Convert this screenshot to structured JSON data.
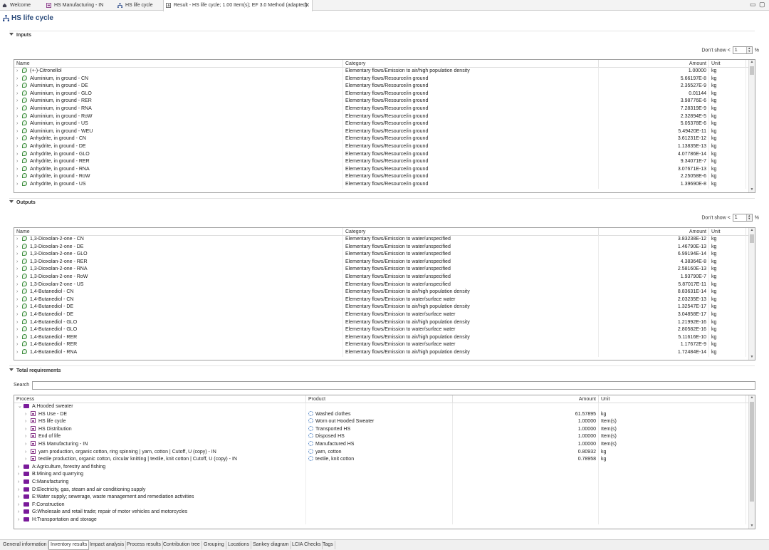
{
  "tabs": [
    {
      "label": "Welcome"
    },
    {
      "label": "HS Manufacturing - IN"
    },
    {
      "label": "HS life cycle"
    },
    {
      "label": "Result - HS life cycle; 1.00 Item(s); EF 3.0 Method (adapted)"
    }
  ],
  "window_controls": {
    "minimize": "▭",
    "maximize": "▢"
  },
  "page_title": "HS life cycle",
  "inputs": {
    "section_label": "Inputs",
    "dont_show_label": "Don't show <",
    "dont_show_value": "1",
    "percent": "%",
    "columns": [
      "Name",
      "Category",
      "Amount",
      "Unit"
    ],
    "rows": [
      [
        "(+-)-Citronellol",
        "Elementary flows/Emission to air/high population density",
        "1.00000",
        "kg"
      ],
      [
        "Aluminium, in ground - CN",
        "Elementary flows/Resource/in ground",
        "5.66197E-8",
        "kg"
      ],
      [
        "Aluminium, in ground - DE",
        "Elementary flows/Resource/in ground",
        "2.35527E-9",
        "kg"
      ],
      [
        "Aluminium, in ground - GLO",
        "Elementary flows/Resource/in ground",
        "0.01144",
        "kg"
      ],
      [
        "Aluminium, in ground - RER",
        "Elementary flows/Resource/in ground",
        "3.98776E-6",
        "kg"
      ],
      [
        "Aluminium, in ground - RNA",
        "Elementary flows/Resource/in ground",
        "7.28319E-9",
        "kg"
      ],
      [
        "Aluminium, in ground - RoW",
        "Elementary flows/Resource/in ground",
        "2.32894E-5",
        "kg"
      ],
      [
        "Aluminium, in ground - US",
        "Elementary flows/Resource/in ground",
        "5.05378E-6",
        "kg"
      ],
      [
        "Aluminium, in ground - WEU",
        "Elementary flows/Resource/in ground",
        "5.49420E-11",
        "kg"
      ],
      [
        "Anhydrite, in ground - CN",
        "Elementary flows/Resource/in ground",
        "3.61231E-12",
        "kg"
      ],
      [
        "Anhydrite, in ground - DE",
        "Elementary flows/Resource/in ground",
        "1.13835E-13",
        "kg"
      ],
      [
        "Anhydrite, in ground - GLO",
        "Elementary flows/Resource/in ground",
        "4.07786E-14",
        "kg"
      ],
      [
        "Anhydrite, in ground - RER",
        "Elementary flows/Resource/in ground",
        "9.34071E-7",
        "kg"
      ],
      [
        "Anhydrite, in ground - RNA",
        "Elementary flows/Resource/in ground",
        "3.07671E-13",
        "kg"
      ],
      [
        "Anhydrite, in ground - RoW",
        "Elementary flows/Resource/in ground",
        "2.25058E-6",
        "kg"
      ],
      [
        "Anhydrite, in ground - US",
        "Elementary flows/Resource/in ground",
        "1.39690E-8",
        "kg"
      ]
    ]
  },
  "outputs": {
    "section_label": "Outputs",
    "dont_show_label": "Don't show <",
    "dont_show_value": "1",
    "percent": "%",
    "columns": [
      "Name",
      "Category",
      "Amount",
      "Unit"
    ],
    "rows": [
      [
        "1,3-Dioxolan-2-one - CN",
        "Elementary flows/Emission to water/unspecified",
        "3.83238E-12",
        "kg"
      ],
      [
        "1,3-Dioxolan-2-one - DE",
        "Elementary flows/Emission to water/unspecified",
        "1.46790E-13",
        "kg"
      ],
      [
        "1,3-Dioxolan-2-one - GLO",
        "Elementary flows/Emission to water/unspecified",
        "6.99194E-14",
        "kg"
      ],
      [
        "1,3-Dioxolan-2-one - RER",
        "Elementary flows/Emission to water/unspecified",
        "4.38364E-8",
        "kg"
      ],
      [
        "1,3-Dioxolan-2-one - RNA",
        "Elementary flows/Emission to water/unspecified",
        "2.58160E-13",
        "kg"
      ],
      [
        "1,3-Dioxolan-2-one - RoW",
        "Elementary flows/Emission to water/unspecified",
        "1.93790E-7",
        "kg"
      ],
      [
        "1,3-Dioxolan-2-one - US",
        "Elementary flows/Emission to water/unspecified",
        "5.87017E-11",
        "kg"
      ],
      [
        "1,4-Butanediol - CN",
        "Elementary flows/Emission to air/high population density",
        "8.83631E-14",
        "kg"
      ],
      [
        "1,4-Butanediol - CN",
        "Elementary flows/Emission to water/surface water",
        "2.03235E-13",
        "kg"
      ],
      [
        "1,4-Butanediol - DE",
        "Elementary flows/Emission to air/high population density",
        "1.32547E-17",
        "kg"
      ],
      [
        "1,4-Butanediol - DE",
        "Elementary flows/Emission to water/surface water",
        "3.04858E-17",
        "kg"
      ],
      [
        "1,4-Butanediol - GLO",
        "Elementary flows/Emission to air/high population density",
        "1.21992E-16",
        "kg"
      ],
      [
        "1,4-Butanediol - GLO",
        "Elementary flows/Emission to water/surface water",
        "2.80582E-16",
        "kg"
      ],
      [
        "1,4-Butanediol - RER",
        "Elementary flows/Emission to air/high population density",
        "5.11616E-10",
        "kg"
      ],
      [
        "1,4-Butanediol - RER",
        "Elementary flows/Emission to water/surface water",
        "1.17672E-9",
        "kg"
      ],
      [
        "1,4-Butanediol - RNA",
        "Elementary flows/Emission to air/high population density",
        "1.72484E-14",
        "kg"
      ]
    ]
  },
  "total_requirements": {
    "section_label": "Total requirements",
    "search_label": "Search",
    "search_value": "",
    "columns": [
      "Process",
      "Product",
      "Amount",
      "Unit"
    ],
    "group": {
      "label": "A:Hooded sweater",
      "expanded": true
    },
    "processes": [
      [
        "HS Use - DE",
        "Washed clothes",
        "61.57895",
        "kg"
      ],
      [
        "HS life cycle",
        "Worn out Hooded Sweater",
        "1.00000",
        "Item(s)"
      ],
      [
        "HS Distribution",
        "Transported HS",
        "1.00000",
        "Item(s)"
      ],
      [
        "End of life",
        "Disposed HS",
        "1.00000",
        "Item(s)"
      ],
      [
        "HS Manufacturing - IN",
        "Manufactured HS",
        "1.00000",
        "Item(s)"
      ],
      [
        "yarn production, organic cotton, ring spinning | yarn, cotton | Cutoff, U (copy) - IN",
        "yarn, cotton",
        "0.80932",
        "kg"
      ],
      [
        "textile production, organic cotton, circular knitting | textile, knit cotton | Cutoff, U (copy) - IN",
        "textile, knit cotton",
        "0.78958",
        "kg"
      ]
    ],
    "categories": [
      "A:Agriculture, forestry and fishing",
      "B:Mining and quarrying",
      "C:Manufacturing",
      "D:Electricity, gas, steam and air conditioning supply",
      "E:Water supply; sewerage, waste management and remediation activities",
      "F:Construction",
      "G:Wholesale and retail trade; repair of motor vehicles and motorcycles",
      "H:Transportation and storage"
    ]
  },
  "bottom_tabs": [
    {
      "label": "General information"
    },
    {
      "label": "Inventory results",
      "active": true
    },
    {
      "label": "Impact analysis"
    },
    {
      "label": "Process results"
    },
    {
      "label": "Contribution tree"
    },
    {
      "label": "Grouping"
    },
    {
      "label": "Locations"
    },
    {
      "label": "Sankey diagram"
    },
    {
      "label": "LCIA Checks"
    },
    {
      "label": "Tags"
    }
  ],
  "colors": {
    "accent": "#2a4a7a",
    "process_icon": "#8a3a8a",
    "folder": "#7a1a9a",
    "flow_icon": "#3a8a3a"
  },
  "icons": {
    "home": "home-icon",
    "process": "process-icon",
    "system": "product-system-icon",
    "result": "result-icon",
    "flow": "elementary-flow-icon",
    "folder": "folder-icon",
    "product": "product-gear-icon"
  }
}
